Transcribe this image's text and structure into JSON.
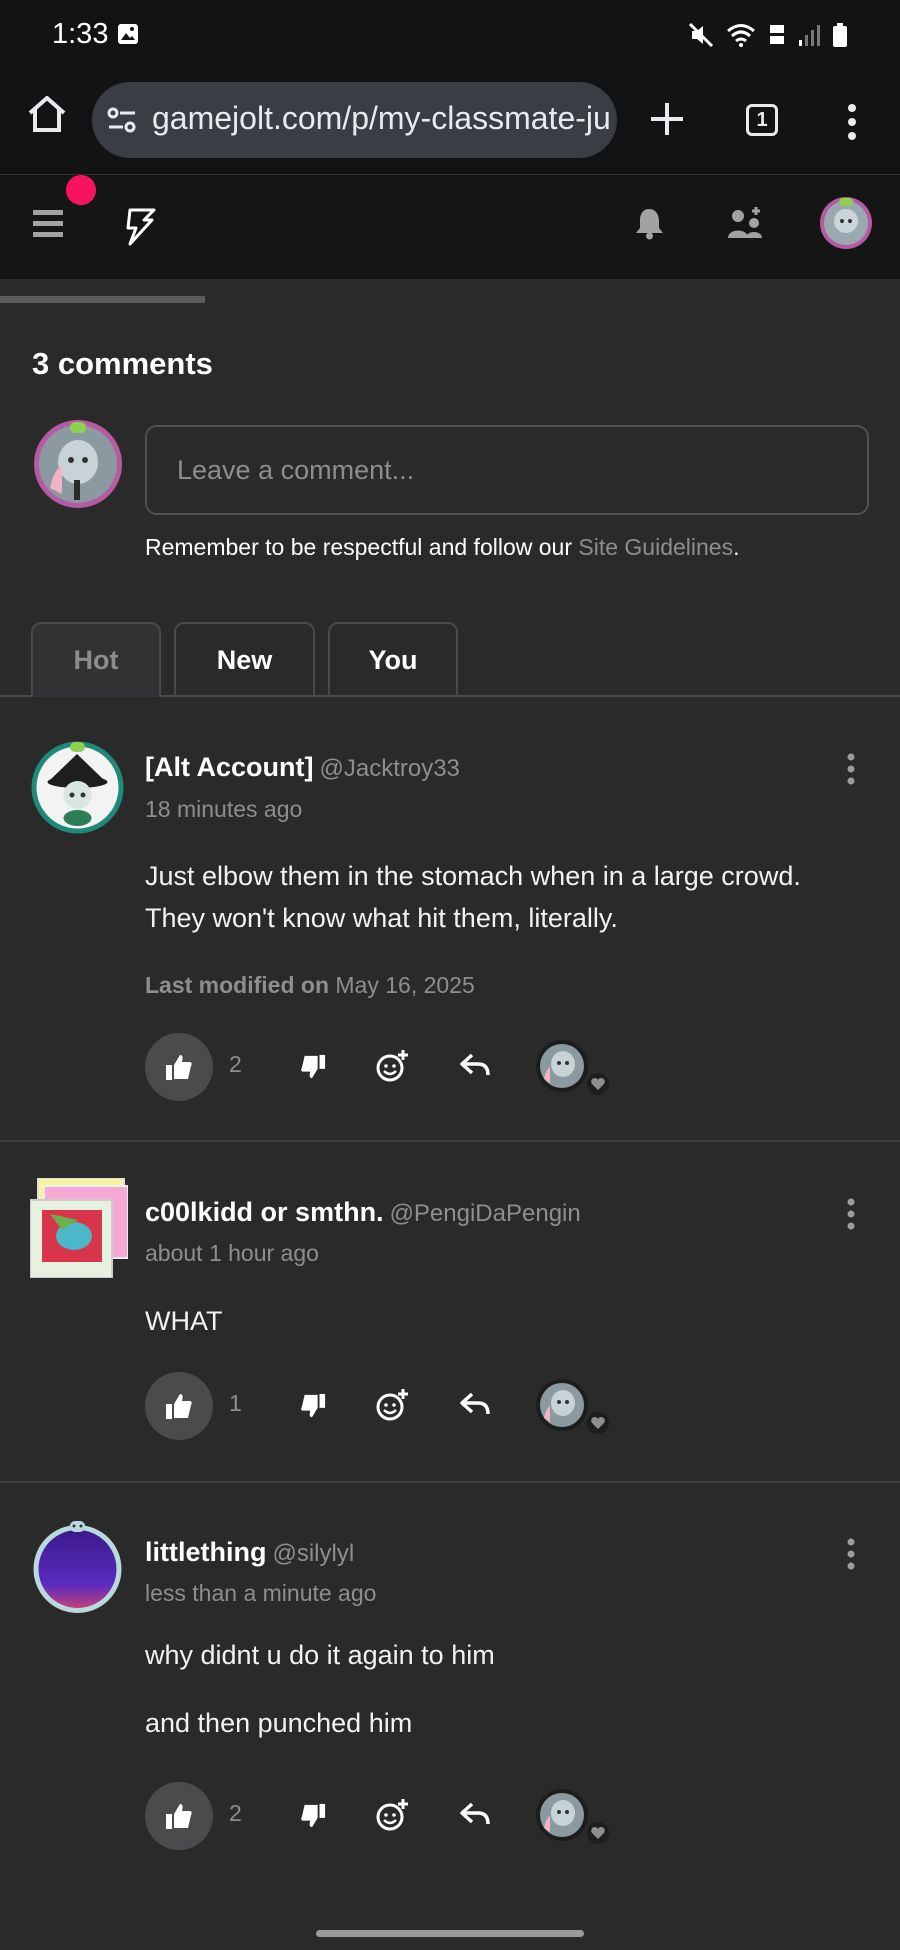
{
  "status": {
    "time": "1:33"
  },
  "browser": {
    "url": "gamejolt.com/p/my-classmate-ju",
    "tab_count": "1"
  },
  "comments_header": "3 comments",
  "composer": {
    "placeholder": "Leave a comment...",
    "guidelines_prefix": "Remember to be respectful and follow our ",
    "guidelines_link": "Site Guidelines",
    "guidelines_suffix": "."
  },
  "tabs": [
    {
      "label": "Hot"
    },
    {
      "label": "New"
    },
    {
      "label": "You"
    }
  ],
  "comments": [
    {
      "name": "[Alt Account]",
      "handle": "@Jacktroy33",
      "time": "18 minutes ago",
      "lines": [
        "Just elbow them in the stomach when in a large crowd.",
        "They won't know what hit them, literally."
      ],
      "modified_label": "Last modified on",
      "modified_date": "May 16, 2025",
      "likes": "2"
    },
    {
      "name": "c00lkidd or smthn.",
      "handle": "@PengiDaPengin",
      "time": "about 1 hour ago",
      "lines": [
        "WHAT"
      ],
      "likes": "1"
    },
    {
      "name": "littlething",
      "handle": "@silylyl",
      "time": "less than a minute ago",
      "lines": [
        "why didnt u do it again to him",
        "and then punched him"
      ],
      "likes": "2"
    }
  ],
  "colors": {
    "background": "#2a2a2b",
    "notification_dot": "#f8135f",
    "muted_text": "#8e8e8f"
  }
}
